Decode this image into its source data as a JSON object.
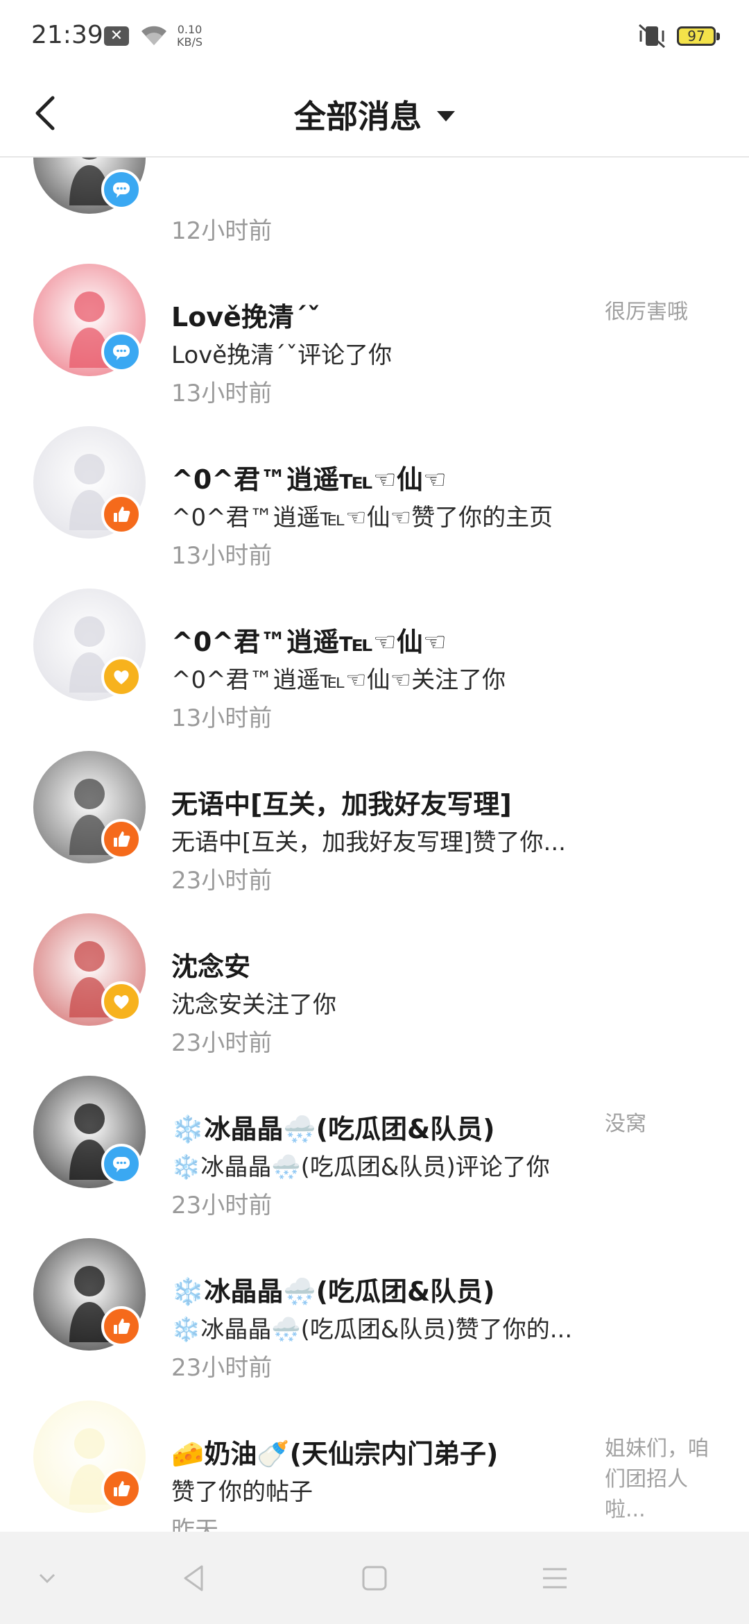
{
  "status_bar": {
    "time": "21:39",
    "notif_icon": "x-notification-icon",
    "net_speed_value": "0.10",
    "net_speed_unit": "KB/S",
    "battery": "97"
  },
  "header": {
    "title": "全部消息"
  },
  "messages": [
    {
      "name": "",
      "text": "",
      "time": "12小时前",
      "side": "",
      "badge": "comment",
      "avatar_color": "#222222"
    },
    {
      "name": "Lově挽清ˊˇ",
      "text": "Lově挽清ˊˇ评论了你",
      "time": "13小时前",
      "side": "很厉害哦",
      "badge": "comment",
      "avatar_color": "#e85a6a"
    },
    {
      "name": "^0^君™逍遥℡☜仙☜",
      "text": "^0^君™逍遥℡☜仙☜赞了你的主页",
      "time": "13小时前",
      "side": "",
      "badge": "like",
      "avatar_color": "#d8d8e0"
    },
    {
      "name": "^0^君™逍遥℡☜仙☜",
      "text": "^0^君™逍遥℡☜仙☜关注了你",
      "time": "13小时前",
      "side": "",
      "badge": "follow",
      "avatar_color": "#d8d8e0"
    },
    {
      "name": "无语中[互关，加我好友写理]",
      "text": "无语中[互关，加我好友写理]赞了你...",
      "time": "23小时前",
      "side": "",
      "badge": "like",
      "avatar_color": "#4a4a4a"
    },
    {
      "name": "沈念安",
      "text": "沈念安关注了你",
      "time": "23小时前",
      "side": "",
      "badge": "follow",
      "avatar_color": "#c84a4a"
    },
    {
      "name": "❄️冰晶晶🌨️(吃瓜团&队员)",
      "text": "❄️冰晶晶🌨️(吃瓜团&队员)评论了你",
      "time": "23小时前",
      "side": "没窝",
      "badge": "comment",
      "avatar_color": "#111111"
    },
    {
      "name": "❄️冰晶晶🌨️(吃瓜团&队员)",
      "text": "❄️冰晶晶🌨️(吃瓜团&队员)赞了你的...",
      "time": "23小时前",
      "side": "",
      "badge": "like",
      "avatar_color": "#111111"
    },
    {
      "name": "🧀奶油🍼(天仙宗内门弟子)",
      "text": "赞了你的帖子",
      "time": "昨天",
      "side": "姐妹们，咱们团招人啦...",
      "badge": "like",
      "avatar_color": "#fbf6d0"
    }
  ],
  "nav": {
    "icons": [
      "chevron-down-icon",
      "back-triangle-icon",
      "home-square-icon",
      "menu-lines-icon"
    ]
  }
}
